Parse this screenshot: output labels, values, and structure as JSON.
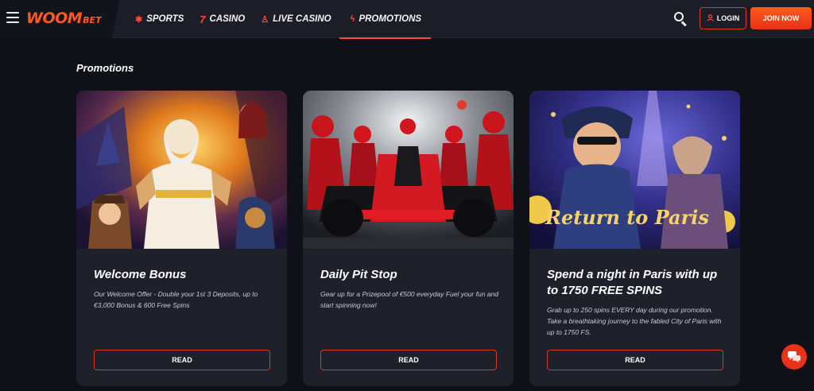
{
  "header": {
    "logo_main": "WOOM",
    "logo_sub": "BET",
    "nav": [
      {
        "label": "SPORTS",
        "icon": "soccer-ball-icon"
      },
      {
        "label": "CASINO",
        "icon": "seven-icon"
      },
      {
        "label": "LIVE CASINO",
        "icon": "dealer-icon"
      },
      {
        "label": "PROMOTIONS",
        "icon": "lightning-icon",
        "active": true
      }
    ],
    "login_label": "LOGIN",
    "join_label": "JOIN NOW"
  },
  "colors": {
    "accent": "#ff4b2b",
    "background": "#0f1117",
    "card": "#1e212a",
    "header": "#1b1e27"
  },
  "page": {
    "title": "Promotions"
  },
  "promotions": [
    {
      "title": "Welcome Bonus",
      "description": "Our Welcome Offer - Double your 1st 3 Deposits, up to €3,000 Bonus & 600 Free Spins",
      "button": "READ"
    },
    {
      "title": "Daily Pit Stop",
      "description": "Gear up for a Prizepool of €500 everyday Fuel your fun and start spinning now!",
      "button": "READ"
    },
    {
      "title": "Spend a night in Paris with up to 1750 FREE SPINS",
      "description": "Grab up to 250 spins EVERY day during our promotion. Take a breathtaking journey to the fabled City of Paris with up to 1750 FS.",
      "button": "READ",
      "image_caption": "Return to Paris"
    }
  ],
  "chat": {
    "icon": "chat-bubble-icon"
  }
}
